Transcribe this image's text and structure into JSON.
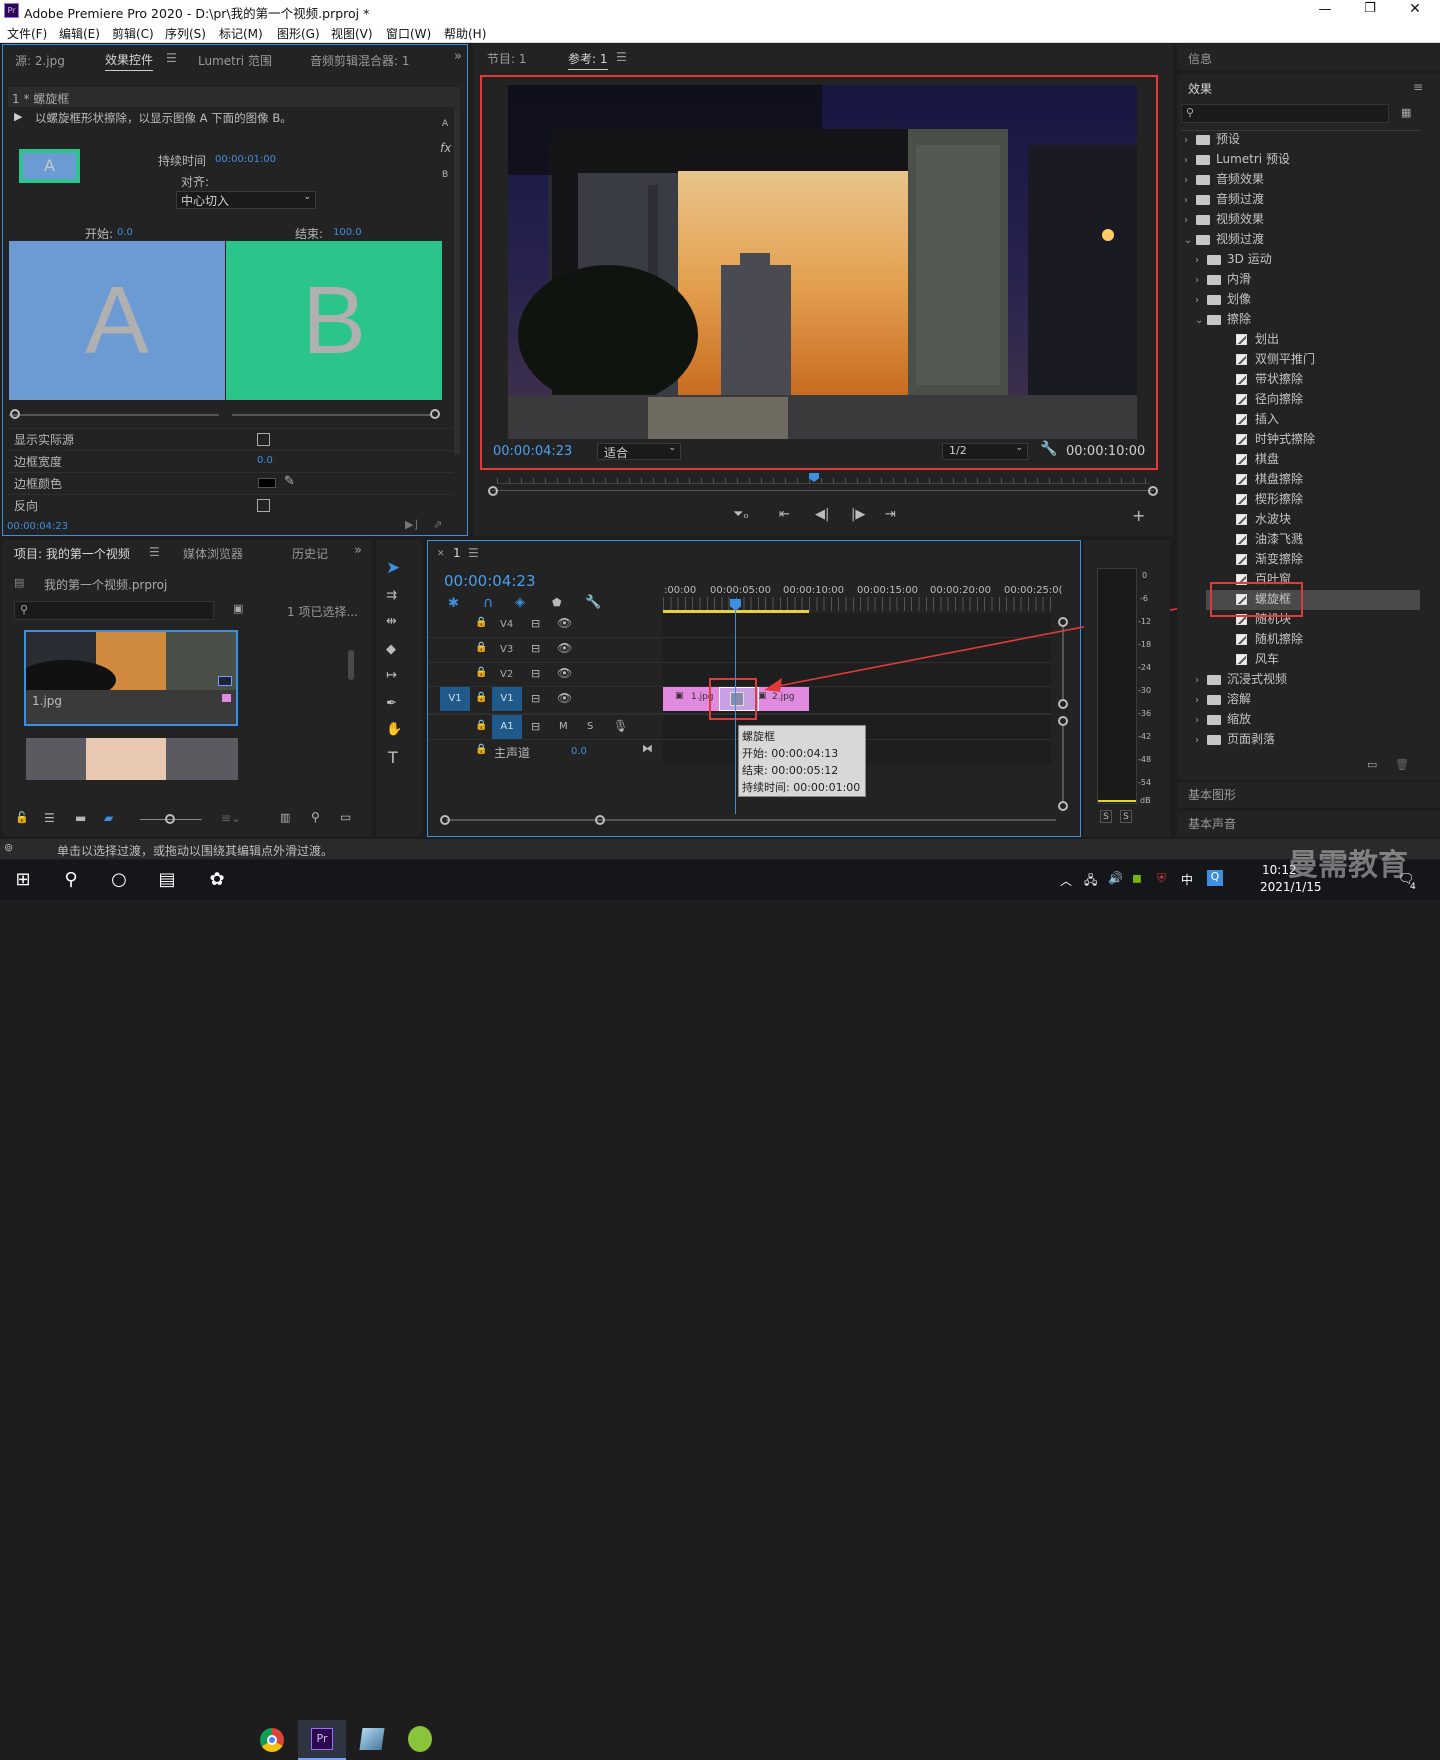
{
  "window": {
    "title": "Adobe Premiere Pro 2020 - D:\\pr\\我的第一个视频.prproj *",
    "app_icon": "Pr",
    "controls": [
      "—",
      "❐",
      "✕"
    ]
  },
  "menu": [
    "文件(F)",
    "编辑(E)",
    "剪辑(C)",
    "序列(S)",
    "标记(M)",
    "图形(G)",
    "视图(V)",
    "窗口(W)",
    "帮助(H)"
  ],
  "effect_controls": {
    "tabs": [
      "源: 2.jpg",
      "效果控件",
      "Lumetri 范围",
      "音频剪辑混合器: 1"
    ],
    "clip_label": "1 * 螺旋框",
    "description": "以螺旋框形状擦除，以显示图像 A 下面的图像 B。",
    "thumb_label": "A",
    "duration_label": "持续时间",
    "duration_value": "00:00:01:00",
    "align_label": "对齐:",
    "align_value": "中心切入",
    "start_label": "开始:",
    "start_value": "0.0",
    "end_label": "结束:",
    "end_value": "100.0",
    "a_label": "A",
    "b_label": "B",
    "side_letters": [
      "A",
      "fx",
      "B"
    ],
    "props": [
      {
        "label": "显示实际源"
      },
      {
        "label": "边框宽度",
        "value": "0.0"
      },
      {
        "label": "边框颜色"
      },
      {
        "label": "反向"
      }
    ],
    "timecode": "00:00:04:23"
  },
  "monitor": {
    "tabs": [
      "节目: 1",
      "参考: 1"
    ],
    "timecode_left": "00:00:04:23",
    "fit": "适合",
    "quality": "1/2",
    "timecode_right": "00:00:10:00"
  },
  "project": {
    "tabs": [
      "项目: 我的第一个视频",
      "媒体浏览器",
      "历史记"
    ],
    "file": "我的第一个视频.prproj",
    "selected_count": "1 项已选择...",
    "item1": "1.jpg"
  },
  "timeline": {
    "tab": "1",
    "timecode": "00:00:04:23",
    "ruler": [
      ":00:00",
      "00:00:05:00",
      "00:00:10:00",
      "00:00:15:00",
      "00:00:20:00",
      "00:00:25:0("
    ],
    "tracks": [
      "V4",
      "V3",
      "V2",
      "V1",
      "A1"
    ],
    "master_label": "主声道",
    "master_value": "0.0",
    "clip1": "1.jpg",
    "clip2": "2.jpg",
    "tooltip": {
      "title": "螺旋框",
      "start": "开始: 00:00:04:13",
      "end": "结束: 00:00:05:12",
      "duration": "持续时间: 00:00:01:00"
    }
  },
  "meter": {
    "ticks": [
      "0",
      "-6",
      "-12",
      "-18",
      "-24",
      "-30",
      "-36",
      "-42",
      "-48",
      "-54",
      "dB"
    ],
    "solo": [
      "S",
      "S"
    ]
  },
  "right": {
    "info_tab": "信息",
    "effects_tab": "效果",
    "tree": [
      {
        "label": "预设",
        "level": 0,
        "type": "folder",
        "open": false
      },
      {
        "label": "Lumetri 预设",
        "level": 0,
        "type": "folder",
        "open": false
      },
      {
        "label": "音频效果",
        "level": 0,
        "type": "folder",
        "open": false
      },
      {
        "label": "音频过渡",
        "level": 0,
        "type": "folder",
        "open": false
      },
      {
        "label": "视频效果",
        "level": 0,
        "type": "folder",
        "open": false
      },
      {
        "label": "视频过渡",
        "level": 0,
        "type": "folder",
        "open": true
      },
      {
        "label": "3D 运动",
        "level": 1,
        "type": "folder",
        "open": false
      },
      {
        "label": "内滑",
        "level": 1,
        "type": "folder",
        "open": false
      },
      {
        "label": "划像",
        "level": 1,
        "type": "folder",
        "open": false
      },
      {
        "label": "擦除",
        "level": 1,
        "type": "folder",
        "open": true
      },
      {
        "label": "划出",
        "level": 2,
        "type": "effect"
      },
      {
        "label": "双侧平推门",
        "level": 2,
        "type": "effect"
      },
      {
        "label": "带状擦除",
        "level": 2,
        "type": "effect"
      },
      {
        "label": "径向擦除",
        "level": 2,
        "type": "effect"
      },
      {
        "label": "插入",
        "level": 2,
        "type": "effect"
      },
      {
        "label": "时钟式擦除",
        "level": 2,
        "type": "effect"
      },
      {
        "label": "棋盘",
        "level": 2,
        "type": "effect"
      },
      {
        "label": "棋盘擦除",
        "level": 2,
        "type": "effect"
      },
      {
        "label": "楔形擦除",
        "level": 2,
        "type": "effect"
      },
      {
        "label": "水波块",
        "level": 2,
        "type": "effect"
      },
      {
        "label": "油漆飞溅",
        "level": 2,
        "type": "effect"
      },
      {
        "label": "渐变擦除",
        "level": 2,
        "type": "effect"
      },
      {
        "label": "百叶窗",
        "level": 2,
        "type": "effect"
      },
      {
        "label": "螺旋框",
        "level": 2,
        "type": "effect",
        "selected": true
      },
      {
        "label": "随机块",
        "level": 2,
        "type": "effect"
      },
      {
        "label": "随机擦除",
        "level": 2,
        "type": "effect"
      },
      {
        "label": "风车",
        "level": 2,
        "type": "effect"
      },
      {
        "label": "沉浸式视频",
        "level": 1,
        "type": "folder",
        "open": false
      },
      {
        "label": "溶解",
        "level": 1,
        "type": "folder",
        "open": false
      },
      {
        "label": "缩放",
        "level": 1,
        "type": "folder",
        "open": false
      },
      {
        "label": "页面剥落",
        "level": 1,
        "type": "folder",
        "open": false
      }
    ],
    "basic_graphics": "基本图形",
    "basic_sound": "基本声音"
  },
  "status": "单击以选择过渡，或拖动以围绕其编辑点外滑过渡。",
  "taskbar": {
    "time": "10:12",
    "date": "2021/1/15",
    "ime": "中",
    "watermark": "曼需教育",
    "badge": "4"
  },
  "colors": {
    "accent": "#3d8fe0",
    "highlight": "#e23a3a",
    "clip": "#e28ae0",
    "a_color": "#6b9bd2",
    "b_color": "#2bc48a"
  }
}
